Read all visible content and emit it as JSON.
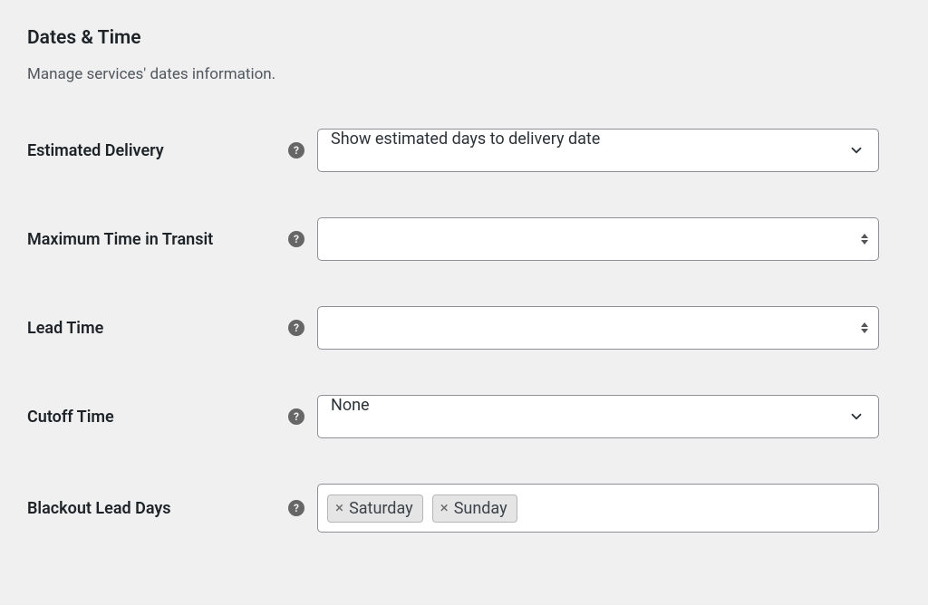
{
  "section": {
    "title": "Dates & Time",
    "description": "Manage services' dates information."
  },
  "fields": {
    "estimatedDelivery": {
      "label": "Estimated Delivery",
      "value": "Show estimated days to delivery date"
    },
    "maxTransit": {
      "label": "Maximum Time in Transit",
      "value": ""
    },
    "leadTime": {
      "label": "Lead Time",
      "value": ""
    },
    "cutoffTime": {
      "label": "Cutoff Time",
      "value": "None"
    },
    "blackoutLeadDays": {
      "label": "Blackout Lead Days",
      "tags": [
        "Saturday",
        "Sunday"
      ]
    }
  },
  "help": {
    "symbol": "?"
  }
}
